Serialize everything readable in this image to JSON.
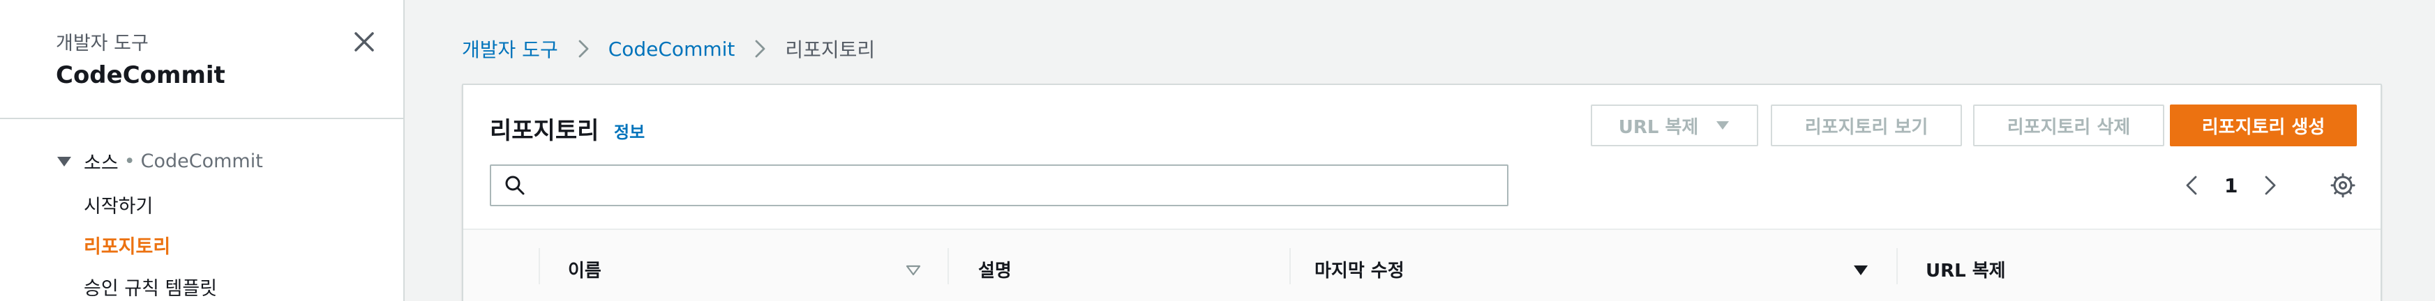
{
  "sidebar": {
    "service_label": "개발자 도구",
    "title": "CodeCommit",
    "group": {
      "label": "소스",
      "separator": "•",
      "sub": "CodeCommit"
    },
    "items": [
      {
        "label": "시작하기",
        "active": false
      },
      {
        "label": "리포지토리",
        "active": true
      },
      {
        "label": "승인 규칙 템플릿",
        "active": false
      }
    ]
  },
  "breadcrumb": [
    {
      "label": "개발자 도구"
    },
    {
      "label": "CodeCommit"
    },
    {
      "label": "리포지토리"
    }
  ],
  "panel": {
    "title": "리포지토리",
    "info_link": "정보",
    "buttons": {
      "clone_url": "URL 복제",
      "view": "리포지토리 보기",
      "delete": "리포지토리 삭제",
      "create": "리포지토리 생성"
    },
    "search": {
      "value": "",
      "placeholder": ""
    },
    "pagination": {
      "current_page": "1"
    }
  },
  "table": {
    "columns": [
      {
        "label": "이름",
        "sort": "sortable"
      },
      {
        "label": "설명"
      },
      {
        "label": "마지막 수정",
        "sort": "descending"
      },
      {
        "label": "URL 복제"
      }
    ]
  },
  "colors": {
    "accent_orange": "#ec7211",
    "link_blue": "#0073bb",
    "page_bg": "#f2f3f3",
    "border": "#d5dbdb"
  },
  "icons": [
    "close-icon",
    "caret-down-icon",
    "chevron-right-icon",
    "search-icon",
    "chevron-left-icon",
    "settings-gear-icon",
    "sort-icon"
  ]
}
